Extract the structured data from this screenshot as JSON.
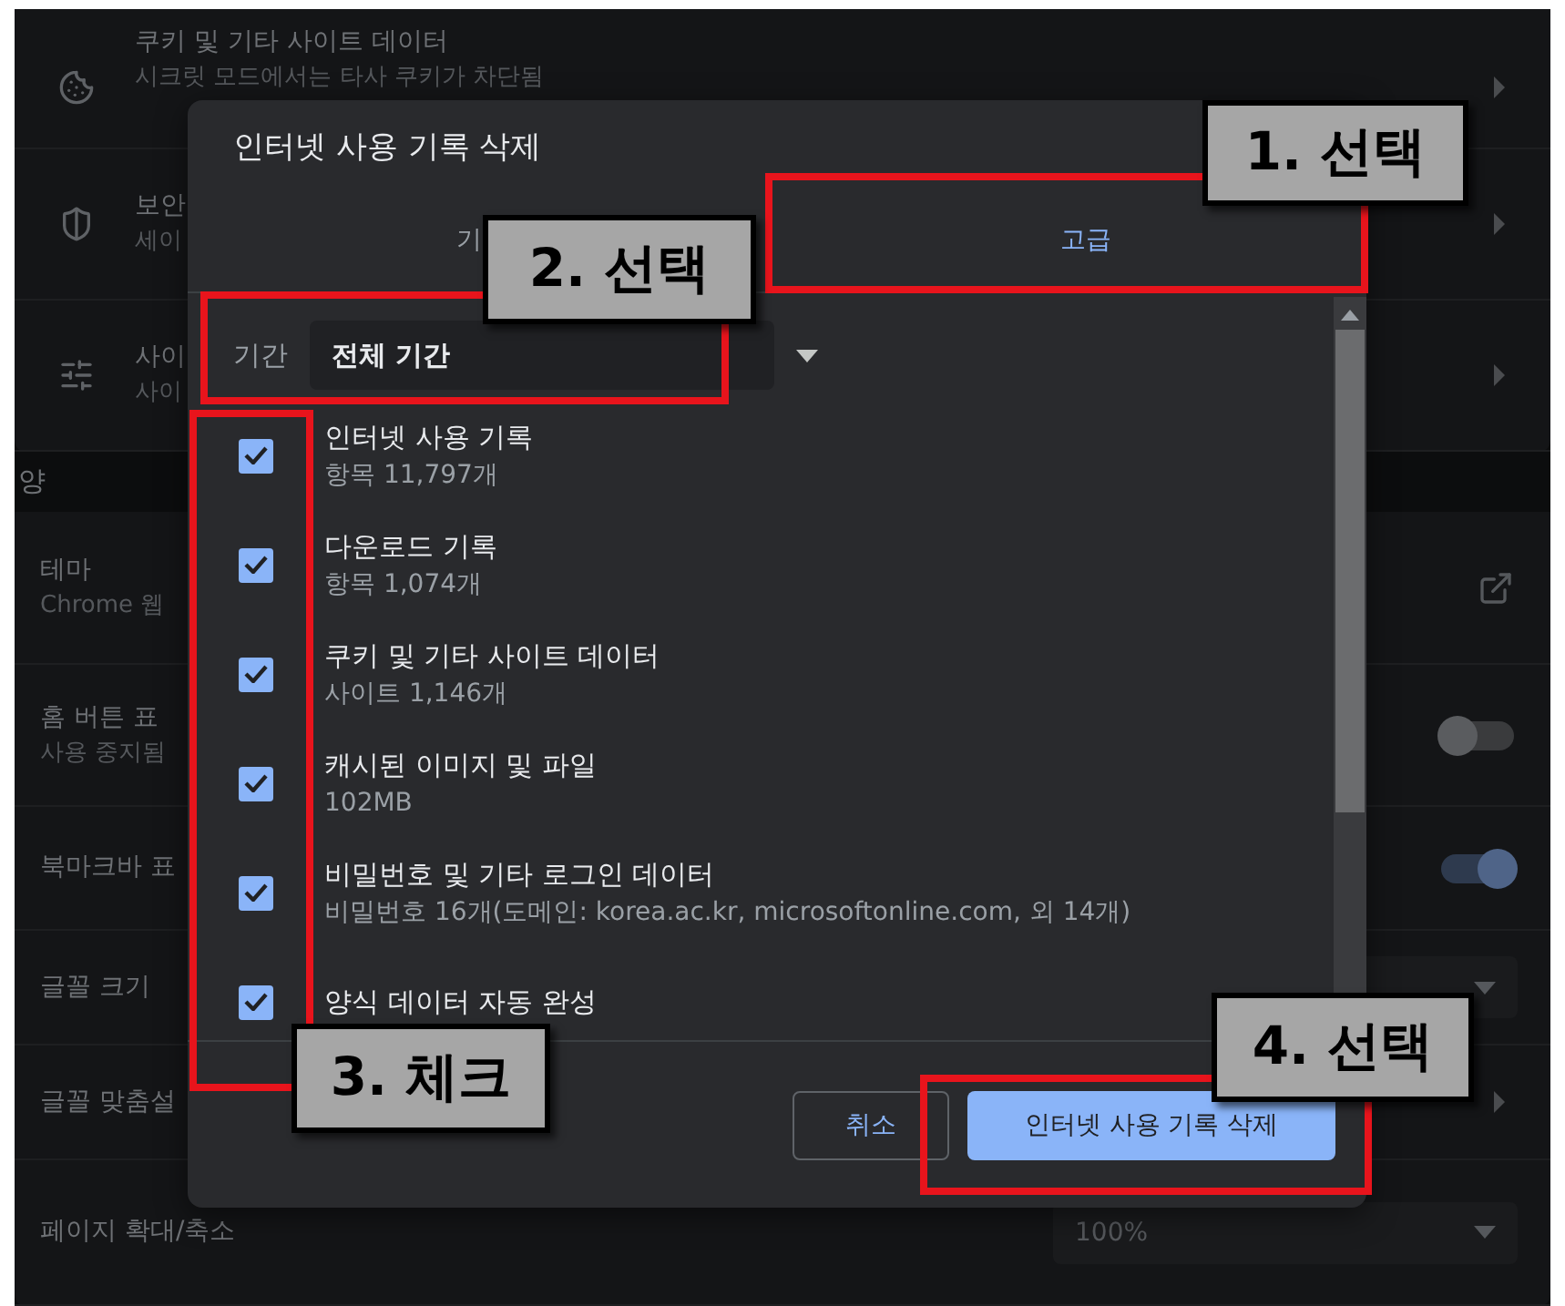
{
  "settings": {
    "privacy_rows": [
      {
        "kind": "link",
        "title": "쿠키 및 기타 사이트 데이터",
        "subtitle": "시크릿 모드에서는 타사 쿠키가 차단됨"
      },
      {
        "kind": "link",
        "title": "보안",
        "subtitle": "세이"
      },
      {
        "kind": "link",
        "title": "사이",
        "subtitle": "사이"
      }
    ],
    "appearance_heading": "양",
    "appearance_rows": [
      {
        "kind": "external",
        "title": "테마",
        "subtitle": "Chrome 웹"
      },
      {
        "kind": "toggle",
        "title": "홈 버튼 표",
        "subtitle": "사용 중지됨",
        "on": false
      },
      {
        "kind": "toggle",
        "title": "북마크바 표",
        "on": true
      },
      {
        "kind": "select",
        "title": "글꼴 크기"
      },
      {
        "kind": "link",
        "title": "글꼴 맞춤설"
      },
      {
        "kind": "select",
        "title": "페이지 확대/축소",
        "value": "100%"
      }
    ]
  },
  "dialog": {
    "title": "인터넷 사용 기록 삭제",
    "tabs": [
      {
        "label": "기",
        "selected": false
      },
      {
        "label": "고급",
        "selected": true
      }
    ],
    "period": {
      "label": "기간",
      "value": "전체 기간"
    },
    "items": [
      {
        "title": "인터넷 사용 기록",
        "subtitle": "항목 11,797개",
        "checked": true
      },
      {
        "title": "다운로드 기록",
        "subtitle": "항목 1,074개",
        "checked": true
      },
      {
        "title": "쿠키 및 기타 사이트 데이터",
        "subtitle": "사이트 1,146개",
        "checked": true
      },
      {
        "title": "캐시된 이미지 및 파일",
        "subtitle": "102MB",
        "checked": true
      },
      {
        "title": "비밀번호 및 기타 로그인 데이터",
        "subtitle": "비밀번호 16개(도메인: korea.ac.kr, microsoftonline.com, 외 14개)",
        "checked": true
      },
      {
        "title": "양식 데이터 자동 완성",
        "checked": true
      }
    ],
    "buttons": [
      {
        "label": "취소",
        "kind": "secondary"
      },
      {
        "label": "인터넷 사용 기록 삭제",
        "kind": "primary"
      }
    ]
  },
  "annotations": [
    {
      "label": "1. 선택"
    },
    {
      "label": "2. 선택"
    },
    {
      "label": "3. 체크"
    },
    {
      "label": "4. 선택"
    }
  ]
}
